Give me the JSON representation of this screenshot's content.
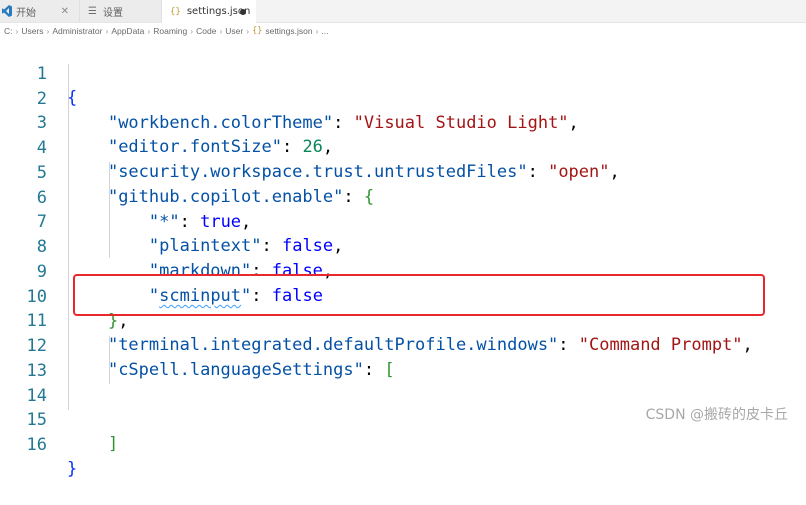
{
  "tabs": [
    {
      "label": "开始",
      "icon": "vscode-icon"
    },
    {
      "label": "设置",
      "icon": "gear-icon"
    },
    {
      "label": "settings.json",
      "icon": "json-braces-icon",
      "modified": true
    }
  ],
  "breadcrumb": [
    "C:",
    "Users",
    "Administrator",
    "AppData",
    "Roaming",
    "Code",
    "User",
    "settings.json",
    "..."
  ],
  "editor": {
    "line_numbers": [
      "1",
      "2",
      "3",
      "4",
      "5",
      "6",
      "7",
      "8",
      "9",
      "10",
      "11",
      "12",
      "13",
      "14",
      "15",
      "16"
    ],
    "line1": {
      "brace": "{"
    },
    "line2": {
      "key": "\"workbench.colorTheme\"",
      "colon": ": ",
      "value": "\"Visual Studio Light\"",
      "comma": ","
    },
    "line3": {
      "key": "\"editor.fontSize\"",
      "colon": ": ",
      "value": "26",
      "comma": ","
    },
    "line4": {
      "key": "\"security.workspace.trust.untrustedFiles\"",
      "colon": ": ",
      "value": "\"open\"",
      "comma": ","
    },
    "line5": {
      "key": "\"github.copilot.enable\"",
      "colon": ": ",
      "value": "{"
    },
    "line6": {
      "key": "\"*\"",
      "colon": ": ",
      "value": "true",
      "comma": ","
    },
    "line7": {
      "key": "\"plaintext\"",
      "colon": ": ",
      "value": "false",
      "comma": ","
    },
    "line8": {
      "key": "\"markdown\"",
      "colon": ": ",
      "value": "false",
      "comma": ","
    },
    "line9": {
      "key_open": "\"",
      "key_word": "scminput",
      "key_close": "\"",
      "colon": ": ",
      "value": "false"
    },
    "line10": {
      "brace": "}",
      "comma": ","
    },
    "line11": {
      "key": "\"terminal.integrated.defaultProfile.windows\"",
      "colon": ": ",
      "value": "\"Command Prompt\"",
      "comma": ","
    },
    "line12": {
      "key": "\"cSpell.languageSettings\"",
      "colon": ": ",
      "value": "["
    },
    "line15": {
      "bracket": "]"
    },
    "line16": {
      "brace": "}"
    }
  },
  "watermark": "CSDN @搬砖的皮卡丘",
  "colors": {
    "highlight_box": "#e8282d",
    "key": "#0451a5",
    "string": "#a31515",
    "boolean": "#0000ff",
    "number": "#098658"
  }
}
